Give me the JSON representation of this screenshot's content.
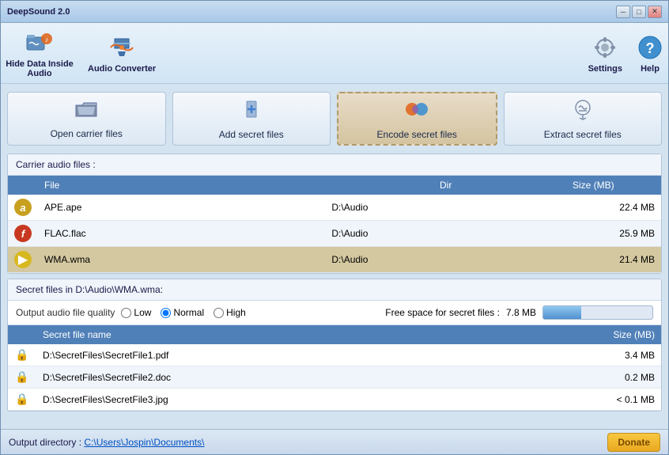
{
  "window": {
    "title": "DeepSound 2.0",
    "min_label": "─",
    "max_label": "□",
    "close_label": "✕"
  },
  "toolbar": {
    "hide_label": "Hide Data Inside Audio",
    "convert_label": "Audio Converter",
    "settings_label": "Settings",
    "help_label": "Help"
  },
  "actions": {
    "open_label": "Open carrier files",
    "add_label": "Add secret files",
    "encode_label": "Encode secret files",
    "extract_label": "Extract secret files"
  },
  "carrier_panel": {
    "header": "Carrier audio files :",
    "columns": [
      "",
      "File",
      "Dir",
      "Size (MB)"
    ],
    "rows": [
      {
        "icon": "a",
        "icon_type": "ape",
        "file": "APE.ape",
        "dir": "D:\\Audio",
        "size": "22.4 MB"
      },
      {
        "icon": "f",
        "icon_type": "flac",
        "file": "FLAC.flac",
        "dir": "D:\\Audio",
        "size": "25.9 MB"
      },
      {
        "icon": "▶",
        "icon_type": "wma",
        "file": "WMA.wma",
        "dir": "D:\\Audio",
        "size": "21.4 MB",
        "selected": true
      }
    ]
  },
  "secret_panel": {
    "header": "Secret files in D:\\Audio\\WMA.wma:",
    "quality_label": "Output audio file quality",
    "quality_options": [
      "Low",
      "Normal",
      "High"
    ],
    "quality_selected": "Normal",
    "free_space_label": "Free space for secret files :",
    "free_space_value": "7.8 MB",
    "progress_percent": 35,
    "columns": [
      "",
      "Secret file name",
      "Size (MB)"
    ],
    "rows": [
      {
        "file": "D:\\SecretFiles\\SecretFile1.pdf",
        "size": "3.4 MB"
      },
      {
        "file": "D:\\SecretFiles\\SecretFile2.doc",
        "size": "0.2 MB"
      },
      {
        "file": "D:\\SecretFiles\\SecretFile3.jpg",
        "size": "< 0.1 MB"
      }
    ]
  },
  "footer": {
    "dir_label": "Output directory :",
    "dir_path": "C:\\Users\\Jospin\\Documents\\",
    "donate_label": "Donate"
  }
}
